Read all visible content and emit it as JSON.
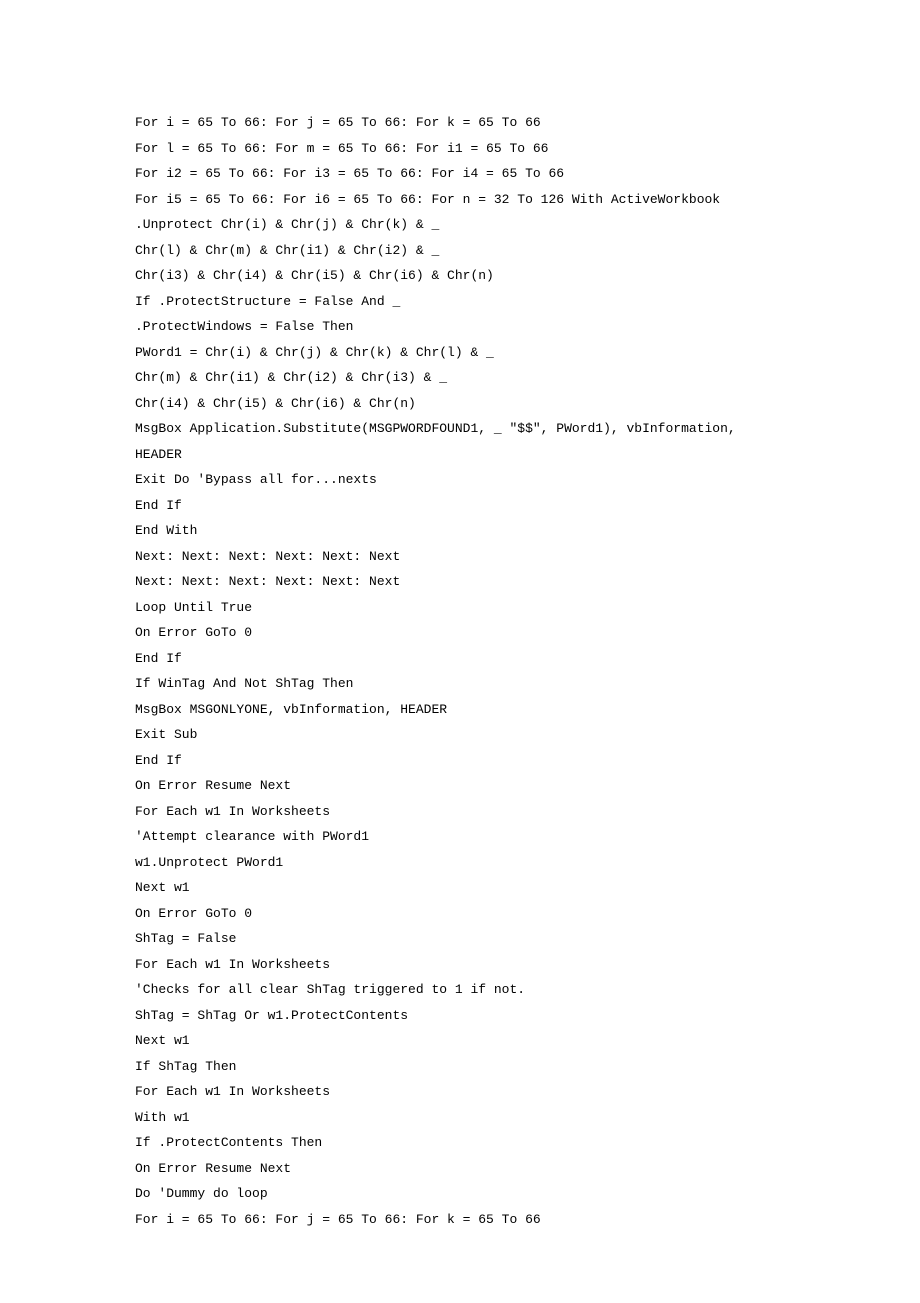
{
  "code_lines": [
    "For i = 65 To 66: For j = 65 To 66: For k = 65 To 66",
    "For l = 65 To 66: For m = 65 To 66: For i1 = 65 To 66",
    "For i2 = 65 To 66: For i3 = 65 To 66: For i4 = 65 To 66",
    "For i5 = 65 To 66: For i6 = 65 To 66: For n = 32 To 126 With ActiveWorkbook",
    ".Unprotect Chr(i) & Chr(j) & Chr(k) & _",
    "Chr(l) & Chr(m) & Chr(i1) & Chr(i2) & _",
    "Chr(i3) & Chr(i4) & Chr(i5) & Chr(i6) & Chr(n)",
    "If .ProtectStructure = False And _",
    ".ProtectWindows = False Then",
    "PWord1 = Chr(i) & Chr(j) & Chr(k) & Chr(l) & _",
    "Chr(m) & Chr(i1) & Chr(i2) & Chr(i3) & _",
    "Chr(i4) & Chr(i5) & Chr(i6) & Chr(n)",
    "MsgBox Application.Substitute(MSGPWORDFOUND1, _ \"$$\", PWord1), vbInformation,",
    "HEADER",
    "Exit Do 'Bypass all for...nexts",
    "End If",
    "End With",
    "Next: Next: Next: Next: Next: Next",
    "Next: Next: Next: Next: Next: Next",
    "Loop Until True",
    "On Error GoTo 0",
    "End If",
    "If WinTag And Not ShTag Then",
    "MsgBox MSGONLYONE, vbInformation, HEADER",
    "Exit Sub",
    "End If",
    "On Error Resume Next",
    "For Each w1 In Worksheets",
    "'Attempt clearance with PWord1",
    "w1.Unprotect PWord1",
    "Next w1",
    "On Error GoTo 0",
    "ShTag = False",
    "For Each w1 In Worksheets",
    "'Checks for all clear ShTag triggered to 1 if not.",
    "ShTag = ShTag Or w1.ProtectContents",
    "Next w1",
    "If ShTag Then",
    "For Each w1 In Worksheets",
    "With w1",
    "If .ProtectContents Then",
    "On Error Resume Next",
    "Do 'Dummy do loop",
    "For i = 65 To 66: For j = 65 To 66: For k = 65 To 66"
  ]
}
